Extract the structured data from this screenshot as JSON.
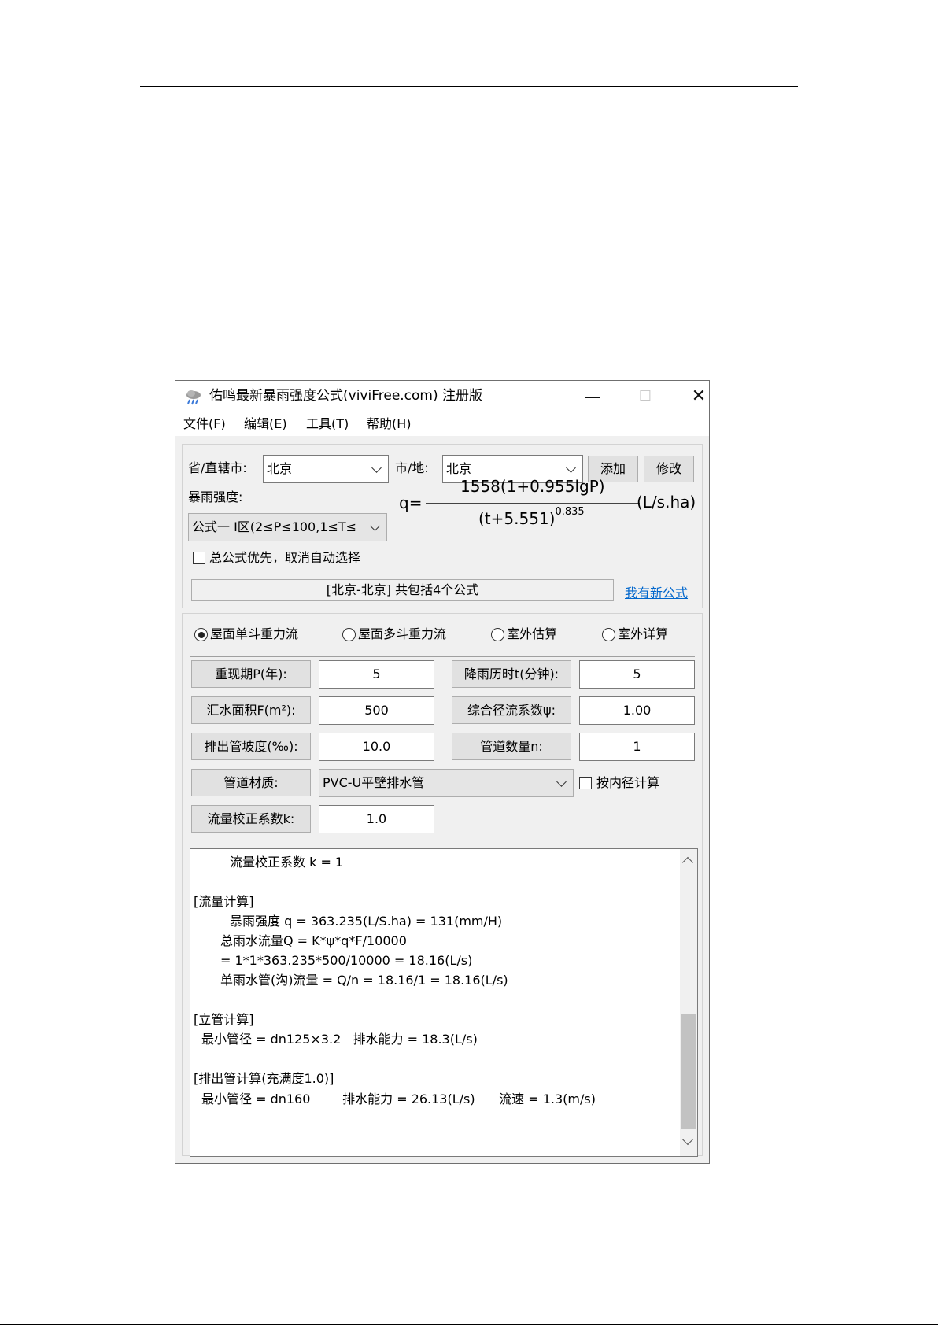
{
  "window": {
    "title": "佑鸣最新暴雨强度公式(viviFree.com) 注册版",
    "controls": {
      "minimize": "—",
      "maximize": "☐",
      "close": "✕"
    }
  },
  "menu": [
    "文件(F)",
    "编辑(E)",
    "工具(T)",
    "帮助(H)"
  ],
  "location": {
    "province_label": "省/直辖市:",
    "province_value": "北京",
    "city_label": "市/地:",
    "city_value": "北京",
    "add_button": "添加",
    "modify_button": "修改"
  },
  "intensity": {
    "label": "暴雨强度:",
    "formula_select": "公式一 I区(2≤P≤100,1≤T≤",
    "formula_q": "q=",
    "numerator": "1558(1+0.955lgP)",
    "denominator": "(t+5.551)",
    "exponent": "0.835",
    "unit": "(L/s.ha)",
    "override_checkbox": "总公式优先，取消自动选择",
    "status": "[北京-北京] 共包括4个公式",
    "new_formula_link": "我有新公式"
  },
  "modes": [
    {
      "label": "屋面单斗重力流",
      "selected": true
    },
    {
      "label": "屋面多斗重力流",
      "selected": false
    },
    {
      "label": "室外估算",
      "selected": false
    },
    {
      "label": "室外详算",
      "selected": false
    }
  ],
  "params": {
    "return_period_label": "重现期P(年):",
    "return_period": "5",
    "duration_label": "降雨历时t(分钟):",
    "duration": "5",
    "area_label": "汇水面积F(m²):",
    "area": "500",
    "runoff_label": "综合径流系数ψ:",
    "runoff": "1.00",
    "slope_label": "排出管坡度(‰):",
    "slope": "10.0",
    "pipe_count_label": "管道数量n:",
    "pipe_count": "1",
    "material_label": "管道材质:",
    "material": "PVC-U平壁排水管",
    "inner_diameter_checkbox": "按内径计算",
    "correction_label": "流量校正系数k:",
    "correction": "1.0"
  },
  "result_lines": [
    "流量校正系数 k = 1",
    "[流量计算]",
    "暴雨强度 q = 363.235(L/S.ha) = 131(mm/H)",
    "总雨水流量Q = K*ψ*q*F/10000",
    "= 1*1*363.235*500/10000 = 18.16(L/s)",
    "单雨水管(沟)流量 = Q/n = 18.16/1 = 18.16(L/s)",
    "[立管计算]",
    "最小管径 = dn125×3.2   排水能力 = 18.3(L/s)",
    "[排出管计算(充满度1.0)]",
    "最小管径 = dn160        排水能力 = 26.13(L/s)      流速 = 1.3(m/s)"
  ],
  "icons": [
    "rain-cloud-icon",
    "chevron-down-icon",
    "scroll-up-arrow-icon",
    "scroll-down-arrow-icon"
  ]
}
